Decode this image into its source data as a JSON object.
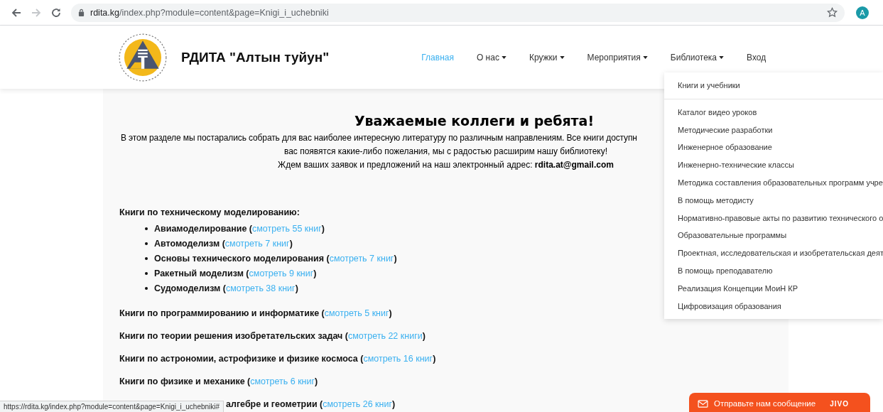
{
  "browser": {
    "url_domain": "rdita.kg",
    "url_path": "/index.php?module=content&page=Knigi_i_uchebniki",
    "back_disabled": false,
    "forward_disabled": true,
    "avatar": "A"
  },
  "site": {
    "title": "РДИТА \"Алтын туйун\""
  },
  "nav": [
    {
      "label": "Главная",
      "selected": true,
      "has_menu": false
    },
    {
      "label": "О нас",
      "selected": false,
      "has_menu": true
    },
    {
      "label": "Кружки",
      "selected": false,
      "has_menu": true
    },
    {
      "label": "Мероприятия",
      "selected": false,
      "has_menu": true
    },
    {
      "label": "Библиотека",
      "selected": false,
      "has_menu": true
    },
    {
      "label": "Вход",
      "selected": false,
      "has_menu": false
    }
  ],
  "dropdown": {
    "items": [
      {
        "label": "Книги и учебники",
        "divider_after": true
      },
      {
        "label": "Каталог видео уроков",
        "divider_after": false
      },
      {
        "label": "Методические разработки",
        "divider_after": false
      },
      {
        "label": "Инженерное образование",
        "divider_after": false
      },
      {
        "label": "Инженерно-технические классы",
        "divider_after": false
      },
      {
        "label": "Методика составления образовательных программ учре",
        "divider_after": false
      },
      {
        "label": "В помощь методисту",
        "divider_after": false
      },
      {
        "label": "Нормативно-правовые акты по развитию технического о",
        "divider_after": false
      },
      {
        "label": "Образовательные программы",
        "divider_after": false
      },
      {
        "label": "Проектная, исследовательская и изобретательская деят",
        "divider_after": false
      },
      {
        "label": "В помощь преподавателю",
        "divider_after": false
      },
      {
        "label": "Реализация Концепции МоиН КР",
        "divider_after": false
      },
      {
        "label": "Цифровизация образования",
        "divider_after": false
      }
    ]
  },
  "content": {
    "heading": "Уважаемые коллеги и ребята!",
    "intro": [
      "В этом разделе мы постарались собрать для вас наиболее интересную литературу по различным направлениям. Все книги доступн",
      "вас появятся какие-либо пожелания, мы с радостью расширим нашу библиотеку!",
      "Ждем ваших заявок и предложений на наш электронный адрес: **rdita.at@gmail.com**"
    ],
    "sections": [
      {
        "kind": "list",
        "title": "Книги по техническому моделированию:",
        "children": [
          {
            "title": "Авиамоделирование (",
            "link": "смотреть 55 книг",
            "suffix": ")"
          },
          {
            "title": "Автомоделизм (",
            "link": "смотреть 7 книг",
            "suffix": ")"
          },
          {
            "title": "Основы технического моделирования (",
            "link": "смотреть 7 книг",
            "suffix": ")"
          },
          {
            "title": "Ракетный моделизм (",
            "link": "смотреть 9 книг",
            "suffix": ")"
          },
          {
            "title": "Судомоделизм (",
            "link": "смотреть 38 книг",
            "suffix": ")"
          }
        ]
      },
      {
        "kind": "link",
        "title": "Книги по программированию и информатике (",
        "link": "смотреть 5 книг",
        "suffix": ")"
      },
      {
        "kind": "link",
        "title": "Книги по теории решения изобретательских задач (",
        "link": "смотреть 22 книги",
        "suffix": ")"
      },
      {
        "kind": "link",
        "title": "Книги по астрономии, астрофизике и физике космоса (",
        "link": "смотреть 16 книг",
        "suffix": ")"
      },
      {
        "kind": "link",
        "title": "Книги по физике и механике (",
        "link": "смотреть 6 книг",
        "suffix": ")"
      },
      {
        "kind": "partial",
        "title": "алгебре и геометрии (",
        "link": "смотреть 26 книг",
        "suffix": ")"
      }
    ]
  },
  "status_url": "https://rdita.kg/index.php?module=content&page=Knigi_i_uchebniki#",
  "chat": {
    "label": "Отправьте нам сообщение",
    "brand": "JIVO"
  }
}
